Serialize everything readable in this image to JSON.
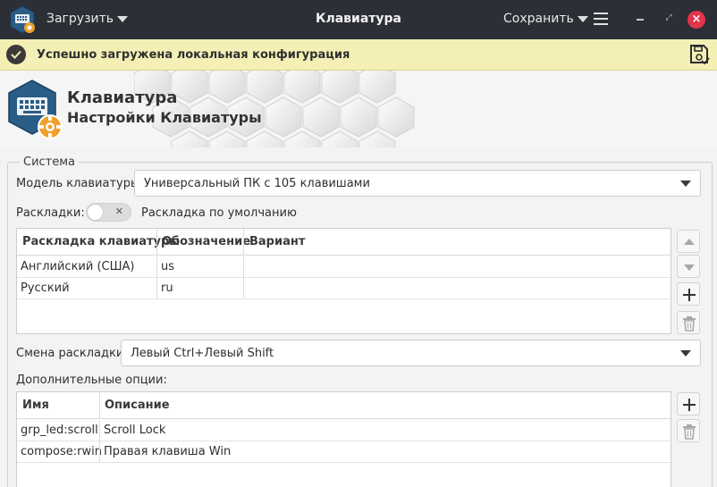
{
  "titlebar": {
    "load_label": "Загрузить",
    "title": "Клавиатура",
    "save_label": "Сохранить"
  },
  "infobar": {
    "message": "Успешно загружена локальная конфигурация"
  },
  "banner": {
    "title": "Клавиатура",
    "subtitle": "Настройки Клавиатуры"
  },
  "system": {
    "group_title": "Система",
    "model_label": "Модель клавиатуры:",
    "model_value": "Универсальный ПК с 105 клавишами",
    "layouts_label": "Раскладки:",
    "default_layout_label": "Раскладка по умолчанию",
    "layouts_table": {
      "columns": [
        "Раскладка клавиатуры",
        "Обозначение",
        "Вариант"
      ],
      "rows": [
        [
          "Английский (США)",
          "us",
          ""
        ],
        [
          "Русский",
          "ru",
          ""
        ]
      ]
    },
    "switch_label": "Смена раскладки:",
    "switch_value": "Левый Ctrl+Левый Shift",
    "options_label": "Дополнительные опции:",
    "options_table": {
      "columns": [
        "Имя",
        "Описание"
      ],
      "rows": [
        [
          "grp_led:scroll",
          "Scroll Lock"
        ],
        [
          "compose:rwin",
          "Правая клавиша Win"
        ]
      ]
    }
  },
  "colors": {
    "titlebar_bg": "#2c2f36",
    "infobar_bg": "#f3efb5",
    "close_button": "#e3344a",
    "logo_blue": "#2a5d86",
    "logo_gear": "#f0a02a"
  },
  "icons": [
    "keyboard-app-icon",
    "check-circle-icon",
    "save-icon",
    "hamburger-menu-icon",
    "minimize-icon",
    "maximize-icon",
    "close-icon",
    "arrow-up-icon",
    "arrow-down-icon",
    "plus-icon",
    "trash-icon"
  ]
}
